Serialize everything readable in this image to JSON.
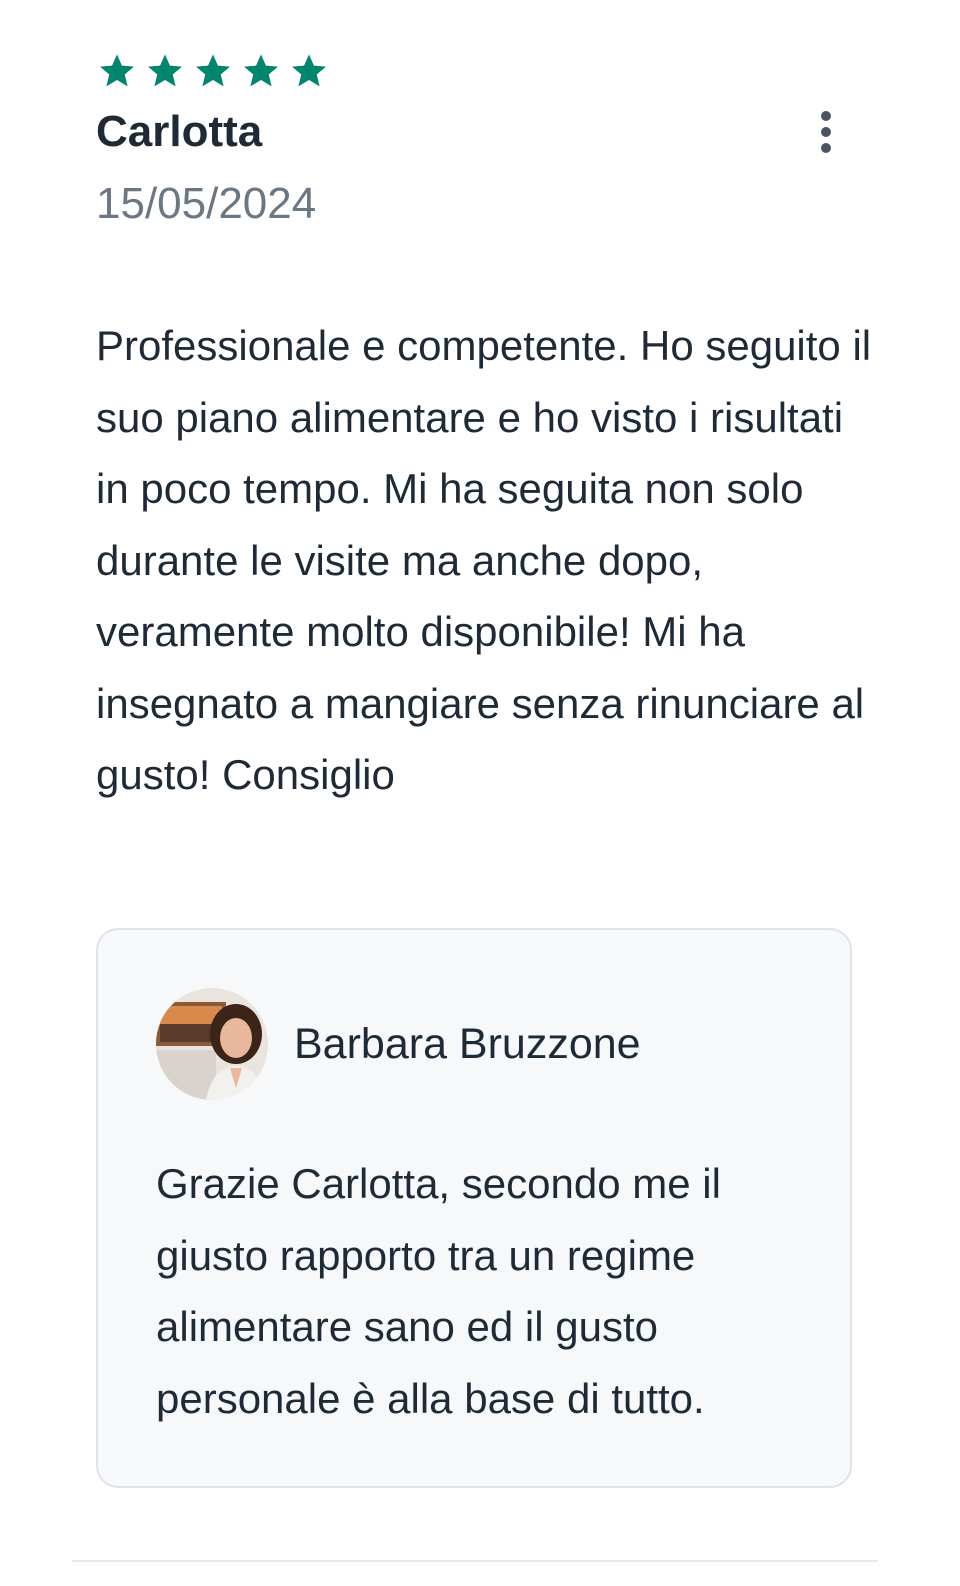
{
  "review": {
    "rating": 5,
    "rating_max": 5,
    "star_color": "#00856f",
    "author": "Carlotta",
    "date": "15/05/2024",
    "text": "Professionale e competente. Ho seguito il suo piano alimentare e ho visto i risultati in poco tempo. Mi ha seguita non solo durante le visite ma anche dopo, veramente molto disponibile! Mi ha insegnato a mangiare senza rinunciare al gusto! Consiglio",
    "more_icon": "more-vertical-icon"
  },
  "reply": {
    "author": "Barbara Bruzzone",
    "avatar_icon": "profile-photo",
    "text": "Grazie Carlotta, secondo me il giusto rapporto tra un regime alimentare sano ed il gusto personale è alla base di tutto."
  }
}
